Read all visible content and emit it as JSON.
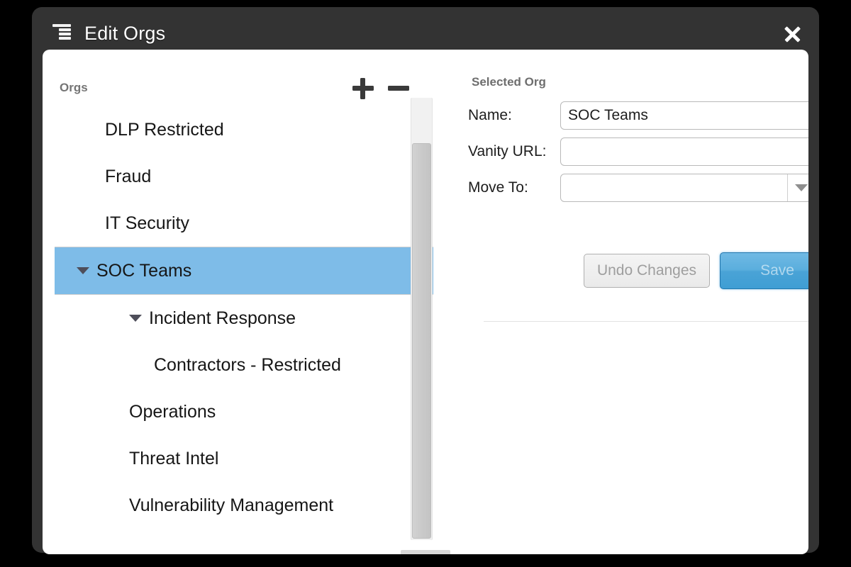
{
  "window": {
    "title": "Edit Orgs",
    "icon": "hierarchy-icon",
    "close_icon": "close-icon"
  },
  "tree_panel": {
    "header_label": "Orgs",
    "add_button_label": "+",
    "remove_button_label": "-",
    "add_icon": "plus-icon",
    "remove_icon": "minus-icon",
    "items": [
      {
        "label": "DLP Restricted",
        "level": 0,
        "expandable": false,
        "expanded": false,
        "selected": false
      },
      {
        "label": "Fraud",
        "level": 0,
        "expandable": false,
        "expanded": false,
        "selected": false
      },
      {
        "label": "IT Security",
        "level": 0,
        "expandable": false,
        "expanded": false,
        "selected": false
      },
      {
        "label": "SOC Teams",
        "level": 0,
        "expandable": true,
        "expanded": true,
        "selected": true
      },
      {
        "label": "Incident Response",
        "level": 1,
        "expandable": true,
        "expanded": true,
        "selected": false
      },
      {
        "label": "Contractors - Restricted",
        "level": 2,
        "expandable": false,
        "expanded": false,
        "selected": false
      },
      {
        "label": "Operations",
        "level": 1,
        "expandable": false,
        "expanded": false,
        "selected": false
      },
      {
        "label": "Threat Intel",
        "level": 1,
        "expandable": false,
        "expanded": false,
        "selected": false
      },
      {
        "label": "Vulnerability Management",
        "level": 1,
        "expandable": false,
        "expanded": false,
        "selected": false
      }
    ],
    "selection_color": "#7ebce8"
  },
  "detail_panel": {
    "section_title": "Selected Org",
    "fields": {
      "name": {
        "label": "Name:",
        "value": "SOC Teams",
        "placeholder": ""
      },
      "vanity_url": {
        "label": "Vanity URL:",
        "value": "",
        "placeholder": ""
      },
      "move_to": {
        "label": "Move To:",
        "value": "",
        "placeholder": "",
        "dropdown_icon": "chevron-down-icon"
      }
    },
    "buttons": {
      "undo": {
        "label": "Undo Changes",
        "enabled": false
      },
      "save": {
        "label": "Save",
        "enabled": false,
        "color": "#4aa3d6"
      }
    }
  }
}
